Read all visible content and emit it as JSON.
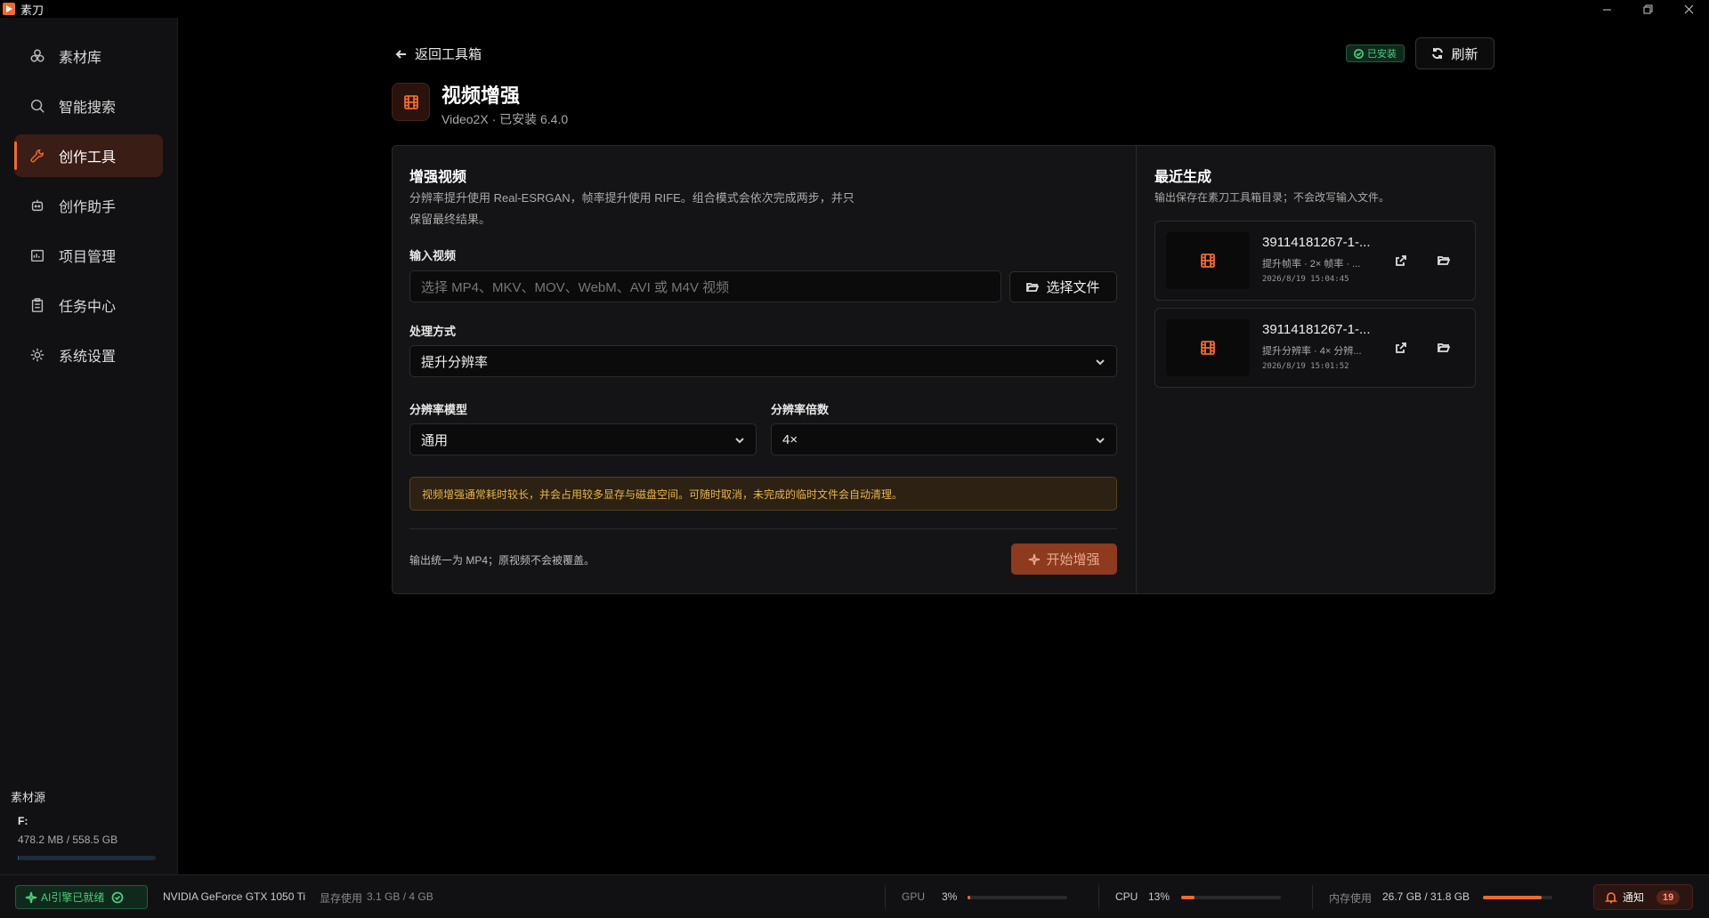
{
  "app": {
    "name": "素刀"
  },
  "sidebar": {
    "items": [
      {
        "label": "素材库",
        "icon": "assets-icon"
      },
      {
        "label": "智能搜索",
        "icon": "search-icon"
      },
      {
        "label": "创作工具",
        "icon": "wrench-icon",
        "active": true
      },
      {
        "label": "创作助手",
        "icon": "bot-icon"
      },
      {
        "label": "项目管理",
        "icon": "project-icon"
      },
      {
        "label": "任务中心",
        "icon": "clipboard-icon"
      },
      {
        "label": "系统设置",
        "icon": "gear-icon"
      }
    ],
    "source": {
      "title": "素材源",
      "drive": "F:",
      "usage": "478.2 MB / 558.5 GB",
      "usage_fraction": 0.001
    }
  },
  "header": {
    "back_label": "返回工具箱",
    "installed_badge": "已安装",
    "refresh_label": "刷新",
    "tool_title": "视频增强",
    "tool_subtitle": "Video2X · 已安装 6.4.0"
  },
  "enhance": {
    "title": "增强视频",
    "desc_line1": "分辨率提升使用 Real-ESRGAN，帧率提升使用 RIFE。组合模式会依次完成两步，并只",
    "desc_line2": "保留最终结果。",
    "input_label": "输入视频",
    "input_placeholder": "选择 MP4、MKV、MOV、WebM、AVI 或 M4V 视频",
    "choose_file_label": "选择文件",
    "mode_label": "处理方式",
    "mode_value": "提升分辨率",
    "model_label": "分辨率模型",
    "model_value": "通用",
    "scale_label": "分辨率倍数",
    "scale_value": "4×",
    "warning": "视频增强通常耗时较长，并会占用较多显存与磁盘空间。可随时取消，未完成的临时文件会自动清理。",
    "output_note": "输出统一为 MP4；原视频不会被覆盖。",
    "start_label": "开始增强"
  },
  "recent": {
    "title": "最近生成",
    "desc": "输出保存在素刀工具箱目录；不会改写输入文件。",
    "items": [
      {
        "name": "39114181267-1-...",
        "meta": "提升帧率 · 2× 帧率 · ...",
        "time": "2026/8/19 15:04:45"
      },
      {
        "name": "39114181267-1-...",
        "meta": "提升分辨率 · 4× 分辨...",
        "time": "2026/8/19 15:01:52"
      }
    ]
  },
  "status": {
    "ai_status": "AI引擎已就绪",
    "gpu_name": "NVIDIA GeForce GTX 1050 Ti",
    "vram_label": "显存使用",
    "vram_value": "3.1 GB / 4 GB",
    "gpu_label": "GPU",
    "gpu_value": "3%",
    "gpu_fraction": 0.03,
    "cpu_label": "CPU",
    "cpu_value": "13%",
    "cpu_fraction": 0.13,
    "mem_label": "内存使用",
    "mem_value": "26.7 GB / 31.8 GB",
    "mem_fraction": 0.84,
    "notify_label": "通知",
    "notify_count": "19"
  },
  "colors": {
    "accent": "#f26a2a",
    "success": "#4ccb7a",
    "warning": "#e7b54a"
  }
}
